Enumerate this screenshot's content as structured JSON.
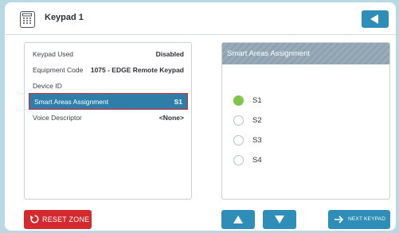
{
  "header": {
    "title": "Keypad 1",
    "icon": "keypad-icon",
    "back_icon": "back-arrow-icon"
  },
  "info": {
    "rows": [
      {
        "label": "Keypad Used",
        "value": "Disabled"
      },
      {
        "label": "Equipment Code",
        "value": "1075 - EDGE Remote Keypad"
      },
      {
        "label": "Device ID",
        "value": ""
      },
      {
        "label": "Smart Areas Assignment",
        "value": "S1",
        "selected": true
      },
      {
        "label": "Voice Descriptor",
        "value": "<None>"
      }
    ]
  },
  "assignment": {
    "title": "Smart Areas Assignment",
    "options": [
      {
        "label": "S1",
        "checked": true
      },
      {
        "label": "S2",
        "checked": false
      },
      {
        "label": "S3",
        "checked": false
      },
      {
        "label": "S4",
        "checked": false
      }
    ]
  },
  "footer": {
    "reset_label": "RESET ZONE",
    "next_label": "NEXT KEYPAD",
    "up_icon": "arrow-up-icon",
    "down_icon": "arrow-down-icon"
  },
  "colors": {
    "accent": "#2e8eb8",
    "danger": "#d4292e",
    "selected_row": "#2e7ea9",
    "radio_on": "#7fc54a",
    "background": "#b8d8e3"
  }
}
